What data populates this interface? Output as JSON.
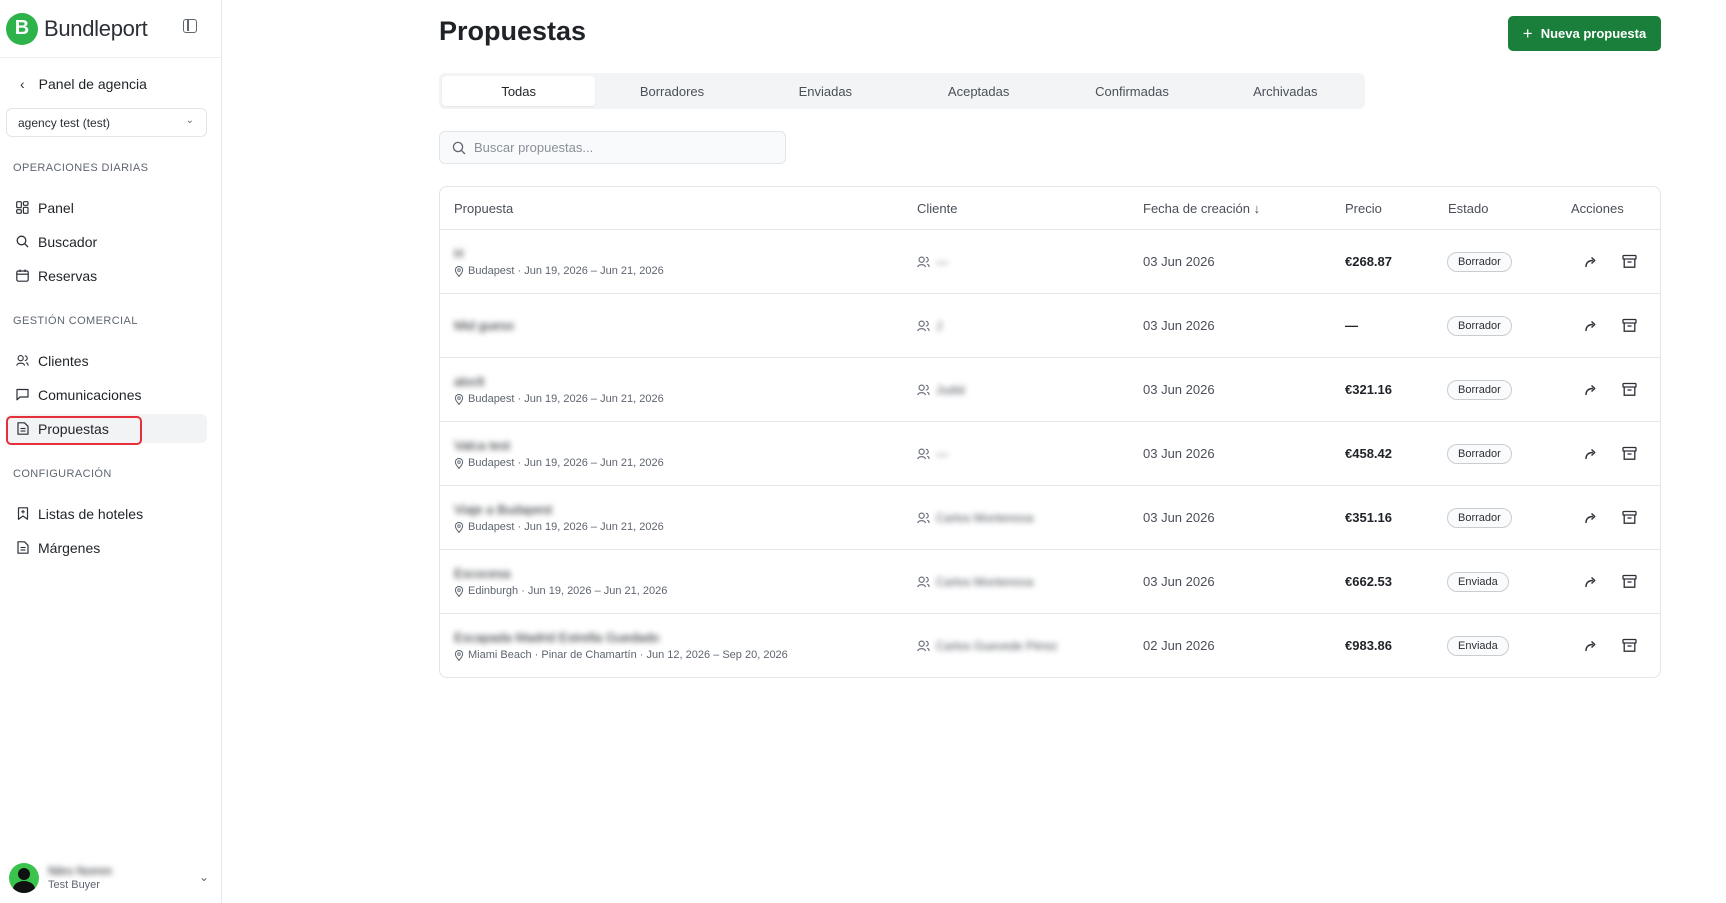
{
  "brand": {
    "name": "Bundleport",
    "logo_letter": "B",
    "color": "#2db34a"
  },
  "sidebar": {
    "back_label": "Panel de agencia",
    "agency_select": "agency test (test)",
    "sections": [
      {
        "title": "OPERACIONES DIARIAS",
        "items": [
          {
            "label": "Panel",
            "icon": "dashboard-icon"
          },
          {
            "label": "Buscador",
            "icon": "search-icon"
          },
          {
            "label": "Reservas",
            "icon": "calendar-icon"
          }
        ]
      },
      {
        "title": "GESTIÓN COMERCIAL",
        "items": [
          {
            "label": "Clientes",
            "icon": "users-icon"
          },
          {
            "label": "Comunicaciones",
            "icon": "message-icon"
          },
          {
            "label": "Propuestas",
            "icon": "document-icon",
            "active": true
          }
        ]
      },
      {
        "title": "CONFIGURACIÓN",
        "items": [
          {
            "label": "Listas de hoteles",
            "icon": "bookmark-icon"
          },
          {
            "label": "Márgenes",
            "icon": "document-icon"
          }
        ]
      }
    ],
    "user": {
      "name": "Nitro Nomm",
      "role": "Test Buyer"
    }
  },
  "main": {
    "title": "Propuestas",
    "new_button": "Nueva propuesta",
    "accent": "#1a7f3a",
    "tabs": [
      "Todas",
      "Borradores",
      "Enviadas",
      "Aceptadas",
      "Confirmadas",
      "Archivadas"
    ],
    "active_tab": 0,
    "search_placeholder": "Buscar propuestas...",
    "columns": [
      "Propuesta",
      "Cliente",
      "Fecha de creación ↓",
      "Precio",
      "Estado",
      "Acciones"
    ],
    "rows": [
      {
        "name": "H",
        "sub": "Budapest · Jun 19, 2026 – Jun 21, 2026",
        "client": "—",
        "date": "03 Jun 2026",
        "price": "€268.87",
        "status": "Borrador"
      },
      {
        "name": "Mid gueso",
        "sub": "",
        "client": "J",
        "date": "03 Jun 2026",
        "price": "—",
        "status": "Borrador"
      },
      {
        "name": "aloclt",
        "sub": "Budapest · Jun 19, 2026 – Jun 21, 2026",
        "client": "Judid",
        "date": "03 Jun 2026",
        "price": "€321.16",
        "status": "Borrador"
      },
      {
        "name": "Valca test",
        "sub": "Budapest · Jun 19, 2026 – Jun 21, 2026",
        "client": "—",
        "date": "03 Jun 2026",
        "price": "€458.42",
        "status": "Borrador"
      },
      {
        "name": "Viaje a Budapest",
        "sub": "Budapest · Jun 19, 2026 – Jun 21, 2026",
        "client": "Carlos Montenova",
        "date": "03 Jun 2026",
        "price": "€351.16",
        "status": "Borrador"
      },
      {
        "name": "Escocesa",
        "sub": "Edinburgh · Jun 19, 2026 – Jun 21, 2026",
        "client": "Carlos Montenova",
        "date": "03 Jun 2026",
        "price": "€662.53",
        "status": "Enviada"
      },
      {
        "name": "Escapada Madrid Estrella Guedado",
        "sub": "Miami Beach · Pinar de Chamartín · Jun 12, 2026 – Sep 20, 2026",
        "client": "Carlos Guevede Pérez",
        "date": "02 Jun 2026",
        "price": "€983.86",
        "status": "Enviada"
      }
    ]
  }
}
